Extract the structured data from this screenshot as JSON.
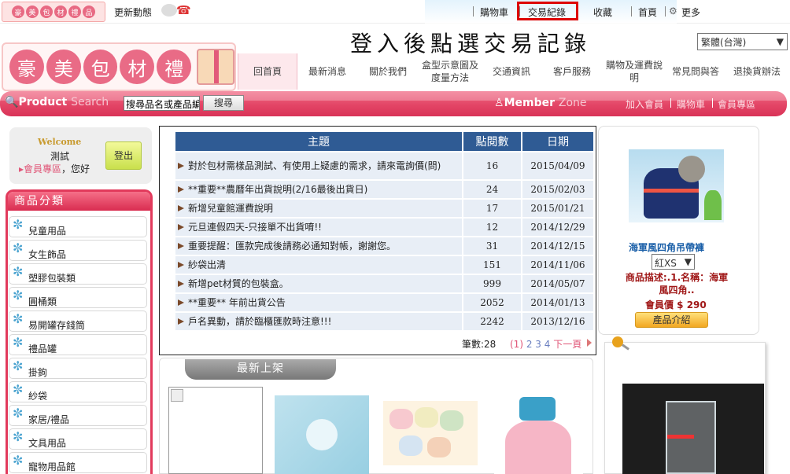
{
  "topbar": {
    "news_label": "更新動態",
    "links": [
      "購物車",
      "交易紀錄",
      "收藏",
      "首頁",
      "更多"
    ]
  },
  "header": {
    "brand_chars": [
      "豪",
      "美",
      "包",
      "材",
      "禮",
      "品"
    ],
    "instruction": "登入後點選交易記錄",
    "language": "繁體(台灣)"
  },
  "nav": {
    "items": [
      "回首頁",
      "最新消息",
      "關於我們",
      "盒型示意圖及\n度量方法",
      "交通資訊",
      "客戶服務",
      "購物及運費說\n明",
      "常見問與答",
      "退換貨辦法"
    ]
  },
  "searchbar": {
    "product_bold": "Product",
    "product_thin": "Search",
    "input_value": "搜尋品名或產品編",
    "button": "搜尋",
    "member_bold": "Member",
    "member_thin": "Zone",
    "links": [
      "加入會員",
      "購物車",
      "會員專區"
    ]
  },
  "login": {
    "welcome": "Welcome",
    "username": "測試",
    "member_link": "會員專區",
    "greeting": "，您好",
    "logout": "登出"
  },
  "categories": {
    "title": "商品分類",
    "items": [
      "兒童用品",
      "女生飾品",
      "塑膠包裝類",
      "圓桶類",
      "易開罐存錢筒",
      "禮品罐",
      "掛鉤",
      "紗袋",
      "家居/禮品",
      "文具用品",
      "寵物用品館"
    ]
  },
  "news": {
    "headers": [
      "主題",
      "點閱數",
      "日期"
    ],
    "rows": [
      {
        "title": "對於包材需樣品測試、有使用上疑慮的需求，請來電詢價(問)",
        "views": "16",
        "date": "2015/04/09"
      },
      {
        "title": "**重要**農曆年出貨說明(2/16最後出貨日)",
        "views": "24",
        "date": "2015/02/03"
      },
      {
        "title": "新增兒童館運費說明",
        "views": "17",
        "date": "2015/01/21"
      },
      {
        "title": "元旦連假四天-只接單不出貨唷!!",
        "views": "12",
        "date": "2014/12/29"
      },
      {
        "title": "重要提醒：匯款完成後請務必通知對帳，謝謝您。",
        "views": "31",
        "date": "2014/12/15"
      },
      {
        "title": "紗袋出清",
        "views": "151",
        "date": "2014/11/06"
      },
      {
        "title": "新增pet材質的包裝盒。",
        "views": "999",
        "date": "2014/05/07"
      },
      {
        "title": "**重要** 年前出貨公告",
        "views": "2052",
        "date": "2014/01/13"
      },
      {
        "title": "戶名異動，請於臨櫃匯款時注意!!!",
        "views": "2242",
        "date": "2013/12/16"
      }
    ],
    "record_count": "筆數:28",
    "pager_current": "(1)",
    "pager_pages": "2 3 4",
    "pager_next": "下一頁"
  },
  "new_arrivals": {
    "title": "最新上架"
  },
  "promo": {
    "title": "海軍風四角吊帶褲",
    "option": "紅XS",
    "desc": "商品描述:.1.名稱：海軍風四角..",
    "price": "會員價 $ 290",
    "button": "產品介紹"
  },
  "colors": {
    "accent_pink": "#e34566",
    "table_header": "#2f5b94",
    "highlight_red": "#dd0000"
  }
}
